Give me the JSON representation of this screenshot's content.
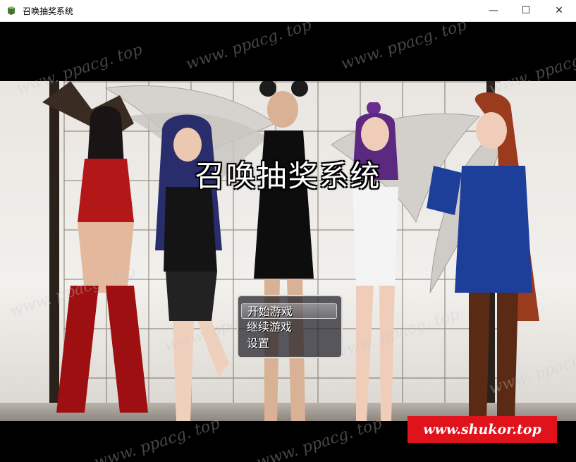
{
  "window": {
    "title": "召唤抽奖系统",
    "controls": {
      "minimize": "—",
      "maximize": "☐",
      "close": "✕"
    }
  },
  "game": {
    "title": "召唤抽奖系统",
    "menu": [
      {
        "label": "开始游戏",
        "selected": true
      },
      {
        "label": "继续游戏",
        "selected": false
      },
      {
        "label": "设置",
        "selected": false
      }
    ]
  },
  "watermark": {
    "text": "www. ppacg. top"
  },
  "badge": {
    "text": "www.shukor.top"
  },
  "colors": {
    "badge_bg": "#e0121c",
    "menu_border": "#d8d8d8"
  },
  "icons": {
    "app": "app-icon"
  }
}
